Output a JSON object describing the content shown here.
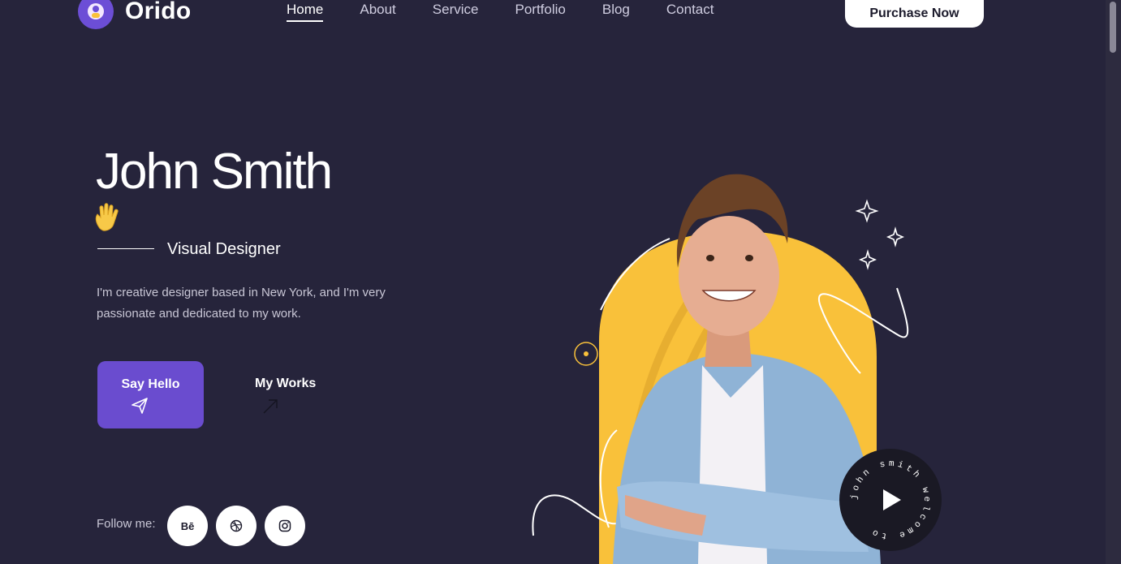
{
  "brand": {
    "name": "Orido"
  },
  "nav": {
    "items": [
      {
        "label": "Home",
        "active": true
      },
      {
        "label": "About"
      },
      {
        "label": "Service"
      },
      {
        "label": "Portfolio"
      },
      {
        "label": "Blog"
      },
      {
        "label": "Contact"
      }
    ]
  },
  "header": {
    "purchase_label": "Purchase Now"
  },
  "hero": {
    "name": "John Smith",
    "wave_icon": "waving-hand",
    "role": "Visual Designer",
    "bio": "I'm creative designer based in New York, and I'm very passionate and dedicated to my work.",
    "primary_cta": "Say Hello",
    "secondary_cta": "My Works",
    "follow_label": "Follow me:",
    "socials": [
      {
        "name": "behance",
        "label": "Bē"
      },
      {
        "name": "dribbble"
      },
      {
        "name": "instagram"
      }
    ],
    "circle_text": "john smith welcome to",
    "colors": {
      "accent": "#6a4ccf",
      "background": "#26243b",
      "highlight": "#f9c13a"
    }
  }
}
